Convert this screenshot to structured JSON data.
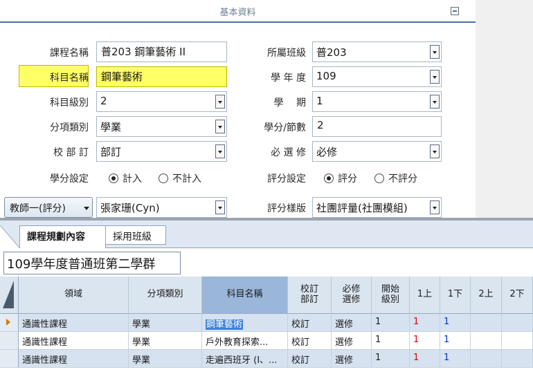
{
  "header": {
    "title": "基本資料"
  },
  "form": {
    "course_name_label": "課程名稱",
    "course_name_value": "普203 鋼筆藝術 II",
    "subject_name_label": "科目名稱",
    "subject_name_value": "鋼筆藝術",
    "subject_level_label": "科目級別",
    "subject_level_value": "2",
    "item_category_label": "分項類別",
    "item_category_value": "學業",
    "school_set_label": "校 部 訂",
    "school_set_value": "部訂",
    "credit_setting_label": "學分設定",
    "credit_count_option": "計入",
    "credit_nocount_option": "不計入",
    "teacher_role_label": "教師一(評分)",
    "teacher_value": "張家珊(Cyn)",
    "class_label": "所屬班級",
    "class_value": "普203",
    "school_year_label": "學 年 度",
    "school_year_value": "109",
    "semester_label": "學　 期",
    "semester_value": "1",
    "credits_label": "學分/節數",
    "credits_value": "2",
    "required_elective_label": "必 選 修",
    "required_elective_value": "必修",
    "grading_setting_label": "評分設定",
    "grading_option": "評分",
    "no_grading_option": "不評分",
    "grading_template_label": "評分樣版",
    "grading_template_value": "社團評量(社團模組)"
  },
  "tabs": [
    {
      "label": "課程規劃內容",
      "active": true
    },
    {
      "label": "採用班級",
      "active": false
    }
  ],
  "group_title": "109學年度普通班第二學群",
  "grid": {
    "headers": [
      "領域",
      "分項類別",
      "科目名稱",
      "校訂\n部訂",
      "必修\n選修",
      "開始\n級別",
      "1上",
      "1下",
      "2上",
      "2下"
    ],
    "rows": [
      {
        "domain": "通識性課程",
        "category": "學業",
        "subject": "鋼筆藝術",
        "school": "校訂",
        "req": "選修",
        "start_level": "1",
        "s1a": "1",
        "s1b": "1",
        "s2a": "",
        "s2b": ""
      },
      {
        "domain": "通識性課程",
        "category": "學業",
        "subject": "戶外教育探索...",
        "school": "校訂",
        "req": "選修",
        "start_level": "1",
        "s1a": "1",
        "s1b": "1",
        "s2a": "",
        "s2b": ""
      },
      {
        "domain": "通識性課程",
        "category": "學業",
        "subject": "走遍西班牙 (I、...",
        "school": "校訂",
        "req": "選修",
        "start_level": "1",
        "s1a": "1",
        "s1b": "1",
        "s2a": "",
        "s2b": ""
      }
    ]
  },
  "colors": {
    "highlight": "#ffff66",
    "header_blue": "#dbe5f0",
    "selected_header": "#9ab6d8",
    "red": "#e00000",
    "blue": "#0033cc"
  },
  "icons": [
    "collapse-icon",
    "dropdown-arrow-icon",
    "radio-icon",
    "current-row-icon"
  ]
}
